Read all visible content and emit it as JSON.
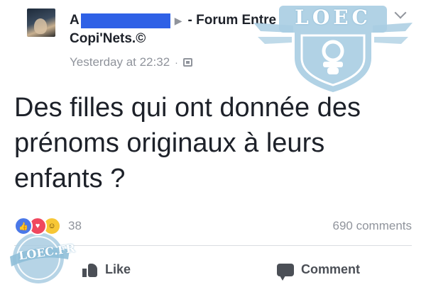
{
  "post": {
    "author_initial": "A",
    "arrow_icon": "right-triangle-icon",
    "group_name_line1": "- Forum Entre",
    "group_name_line2": "Copi'Nets.©",
    "timestamp": "Yesterday at 22:32",
    "separator": "·",
    "audience_icon": "group-icon",
    "text": "Des filles qui ont donnée des prénoms originaux à leurs enfants ?"
  },
  "reactions": {
    "icons": [
      "like-reaction-icon",
      "love-reaction-icon",
      "haha-reaction-icon"
    ],
    "count": "38",
    "comments": "690 comments"
  },
  "actions": {
    "like_label": "Like",
    "comment_label": "Comment"
  },
  "watermarks": {
    "logo_text": "LOEC",
    "badge_text": "LOEC.FR"
  },
  "colors": {
    "redaction": "#2f61e6",
    "text_primary": "#1d2129",
    "text_secondary": "#90949c",
    "watermark": "#a9cde2"
  }
}
